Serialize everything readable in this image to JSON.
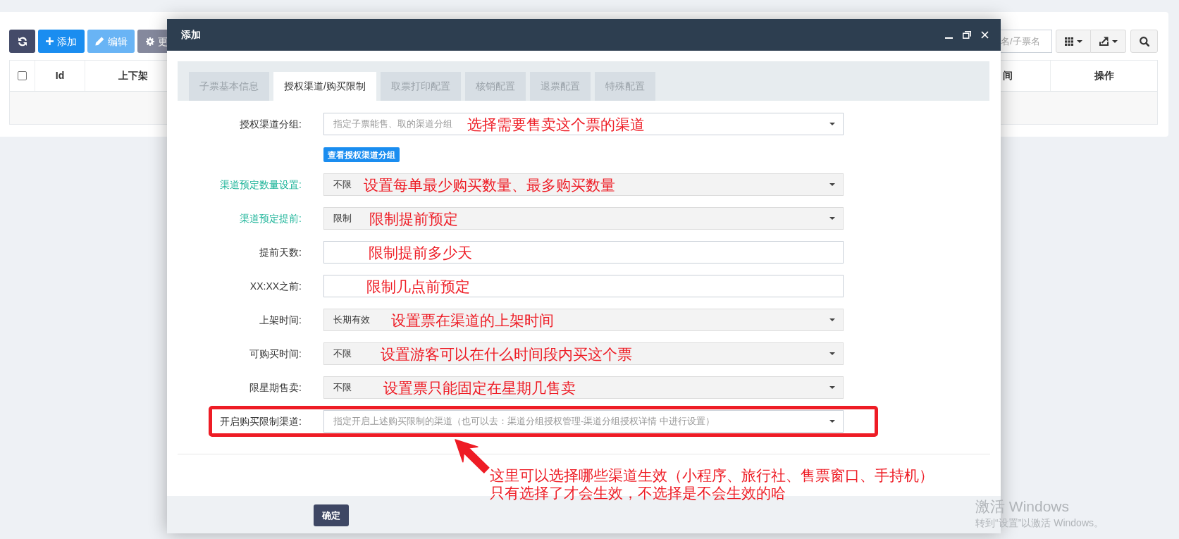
{
  "page": {
    "toolbar": [
      {
        "kind": "refresh",
        "disabled": false
      },
      {
        "kind": "add",
        "label": "添加",
        "disabled": false
      },
      {
        "kind": "edit",
        "label": "编辑",
        "disabled": true
      },
      {
        "kind": "more",
        "label": "更",
        "disabled": true
      }
    ],
    "search": {
      "placeholder": "名/子票名"
    },
    "tool_buttons": [
      {
        "kind": "columns",
        "dropdown": true
      },
      {
        "kind": "export",
        "dropdown": true
      },
      {
        "kind": "search",
        "dropdown": false
      }
    ],
    "table": {
      "columns": [
        {
          "kind": "checkbox",
          "checked": false
        },
        {
          "kind": "text",
          "label": "Id"
        },
        {
          "kind": "text",
          "label": "上下架"
        },
        {
          "kind": "text",
          "label": "间"
        },
        {
          "kind": "text",
          "label": "操作"
        }
      ]
    }
  },
  "dialog": {
    "title": "添加",
    "window_controls": [
      {
        "kind": "minimize"
      },
      {
        "kind": "maximize"
      },
      {
        "kind": "close"
      }
    ],
    "tabs": [
      {
        "label": "子票基本信息",
        "selected": false
      },
      {
        "label": "授权渠道/购买限制",
        "selected": true
      },
      {
        "label": "取票打印配置",
        "selected": false
      },
      {
        "label": "核销配置",
        "selected": false
      },
      {
        "label": "退票配置",
        "selected": false
      },
      {
        "label": "特殊配置",
        "selected": false
      }
    ],
    "form": [
      {
        "label": "授权渠道分组:",
        "highlighted": false,
        "kind": "multiselect",
        "placeholder": "指定子票能售、取的渠道分组",
        "annotation": "选择需要售卖这个票的渠道",
        "boxed": false,
        "link_button": "查看授权渠道分组"
      },
      {
        "label": "渠道预定数量设置:",
        "highlighted": true,
        "kind": "select",
        "value": "不限",
        "annotation": "设置每单最少购买数量、最多购买数量",
        "boxed": false
      },
      {
        "label": "渠道预定提前:",
        "highlighted": true,
        "kind": "select",
        "value": "限制",
        "annotation": "限制提前预定",
        "boxed": false
      },
      {
        "label": "提前天数:",
        "highlighted": false,
        "kind": "input",
        "annotation": "限制提前多少天",
        "boxed": false
      },
      {
        "label": "XX:XX之前:",
        "highlighted": false,
        "kind": "input",
        "annotation": "限制几点前预定",
        "boxed": false
      },
      {
        "label": "上架时间:",
        "highlighted": false,
        "kind": "select",
        "value": "长期有效",
        "annotation": "设置票在渠道的上架时间",
        "boxed": false
      },
      {
        "label": "可购买时间:",
        "highlighted": false,
        "kind": "select",
        "value": "不限",
        "annotation": "设置游客可以在什么时间段内买这个票",
        "boxed": false
      },
      {
        "label": "限星期售卖:",
        "highlighted": false,
        "kind": "select",
        "value": "不限",
        "annotation": "设置票只能固定在星期几售卖",
        "boxed": false
      },
      {
        "label": "开启购买限制渠道:",
        "highlighted": false,
        "kind": "multiselect",
        "placeholder": "指定开启上述购买限制的渠道（也可以去：渠道分组授权管理-渠道分组授权详情 中进行设置）",
        "boxed": true
      }
    ],
    "note": {
      "lines": [
        "这里可以选择哪些渠道生效（小程序、旅行社、售票窗口、手持机）",
        "只有选择了才会生效，不选择是不会生效的哈"
      ]
    },
    "footer": {
      "buttons": [
        {
          "label": "确定"
        }
      ]
    }
  },
  "os_notice": {
    "title": "激活 Windows",
    "subtitle": "转到“设置”以激活 Windows。"
  }
}
